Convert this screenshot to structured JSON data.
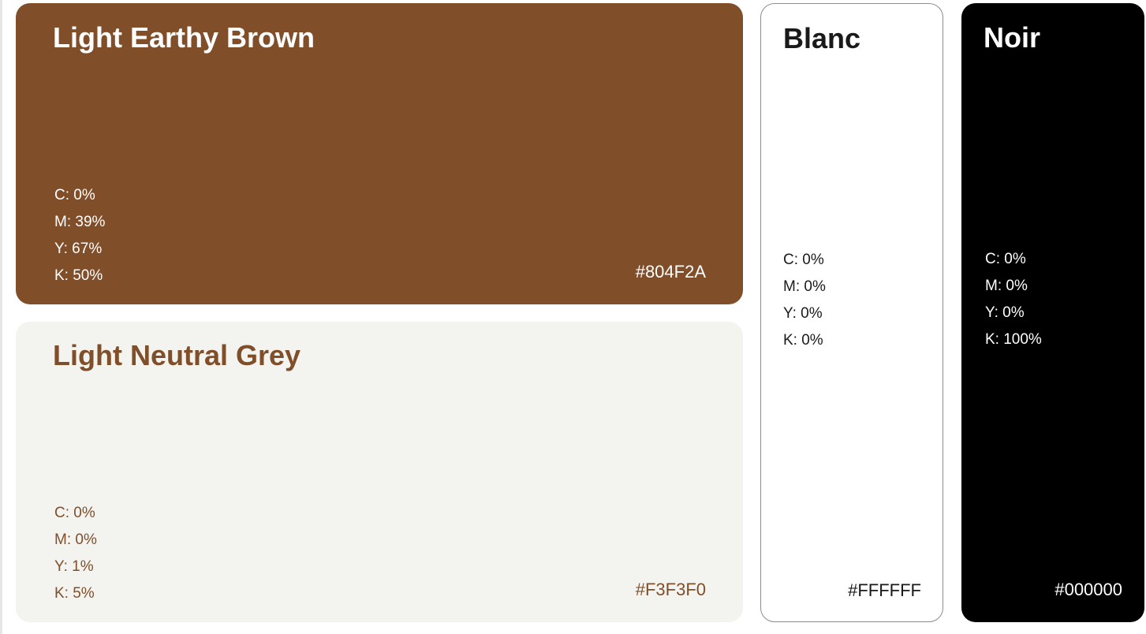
{
  "swatches": {
    "brown": {
      "name": "Light Earthy Brown",
      "cmyk": [
        "C: 0%",
        "M: 39%",
        "Y: 67%",
        "K: 50%"
      ],
      "hex_label": "#804F2A",
      "background": "#804F2A",
      "text_color": "#FFFFFF"
    },
    "grey": {
      "name": "Light Neutral Grey",
      "cmyk": [
        "C: 0%",
        "M: 0%",
        "Y: 1%",
        "K: 5%"
      ],
      "hex_label": "#F3F3F0",
      "background": "#F3F3F0",
      "text_color": "#804F2A"
    },
    "white": {
      "name": "Blanc",
      "cmyk": [
        "C: 0%",
        "M: 0%",
        "Y: 0%",
        "K: 0%"
      ],
      "hex_label": "#FFFFFF",
      "background": "#FFFFFF",
      "text_color": "#1A1A1A"
    },
    "black": {
      "name": "Noir",
      "cmyk": [
        "C: 0%",
        "M: 0%",
        "Y: 0%",
        "K: 100%"
      ],
      "hex_label": "#000000",
      "background": "#000000",
      "text_color": "#FFFFFF"
    }
  }
}
